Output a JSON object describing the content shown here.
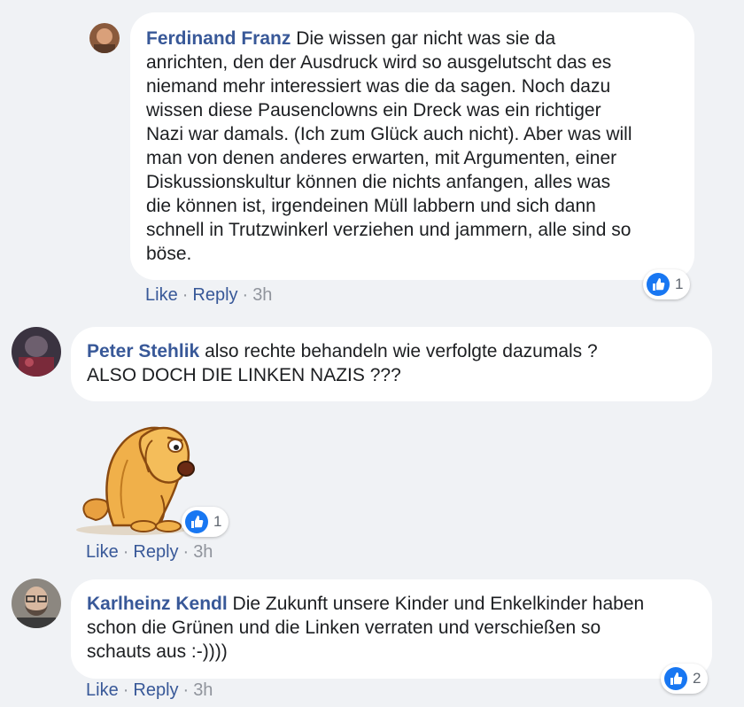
{
  "comments": [
    {
      "author": "Ferdinand Franz",
      "text_lines": [
        "Die wissen gar nicht was sie da",
        "anrichten, den der Ausdruck wird so ausgelutscht das es",
        "niemand mehr interessiert was die da sagen. Noch dazu",
        "wissen diese Pausenclowns ein Dreck was ein richtiger",
        "Nazi war damals. (Ich zum Glück auch nicht). Aber was will",
        "man von denen anderes erwarten, mit Argumenten, einer",
        "Diskussionskultur können die nichts anfangen, alles was",
        "die können ist, irgendeinen Müll labbern und sich dann",
        "schnell in Trutzwinkerl verziehen und jammern, alle sind so",
        "böse."
      ],
      "like_label": "Like",
      "reply_label": "Reply",
      "time": "3h",
      "reaction_count": "1"
    },
    {
      "author": "Peter Stehlik",
      "text_lines": [
        "also rechte behandeln wie verfolgte dazumals ?",
        "ALSO DOCH DIE LINKEN NAZIS ???"
      ],
      "sticker_icon": "sad-cartoon-dog-sticker",
      "like_label": "Like",
      "reply_label": "Reply",
      "time": "3h",
      "reaction_count": "1"
    },
    {
      "author": "Karlheinz Kendl",
      "text_lines": [
        "Die Zukunft unsere Kinder und Enkelkinder haben",
        "schon die Grünen und die Linken verraten und verschießen so",
        "schauts aus :-))))"
      ],
      "like_label": "Like",
      "reply_label": "Reply",
      "time": "3h",
      "reaction_count": "2"
    }
  ],
  "colors": {
    "background": "#f0f2f5",
    "bubble": "#ffffff",
    "author": "#385898",
    "like_blue": "#1877f2",
    "meta_gray": "#90949c"
  }
}
